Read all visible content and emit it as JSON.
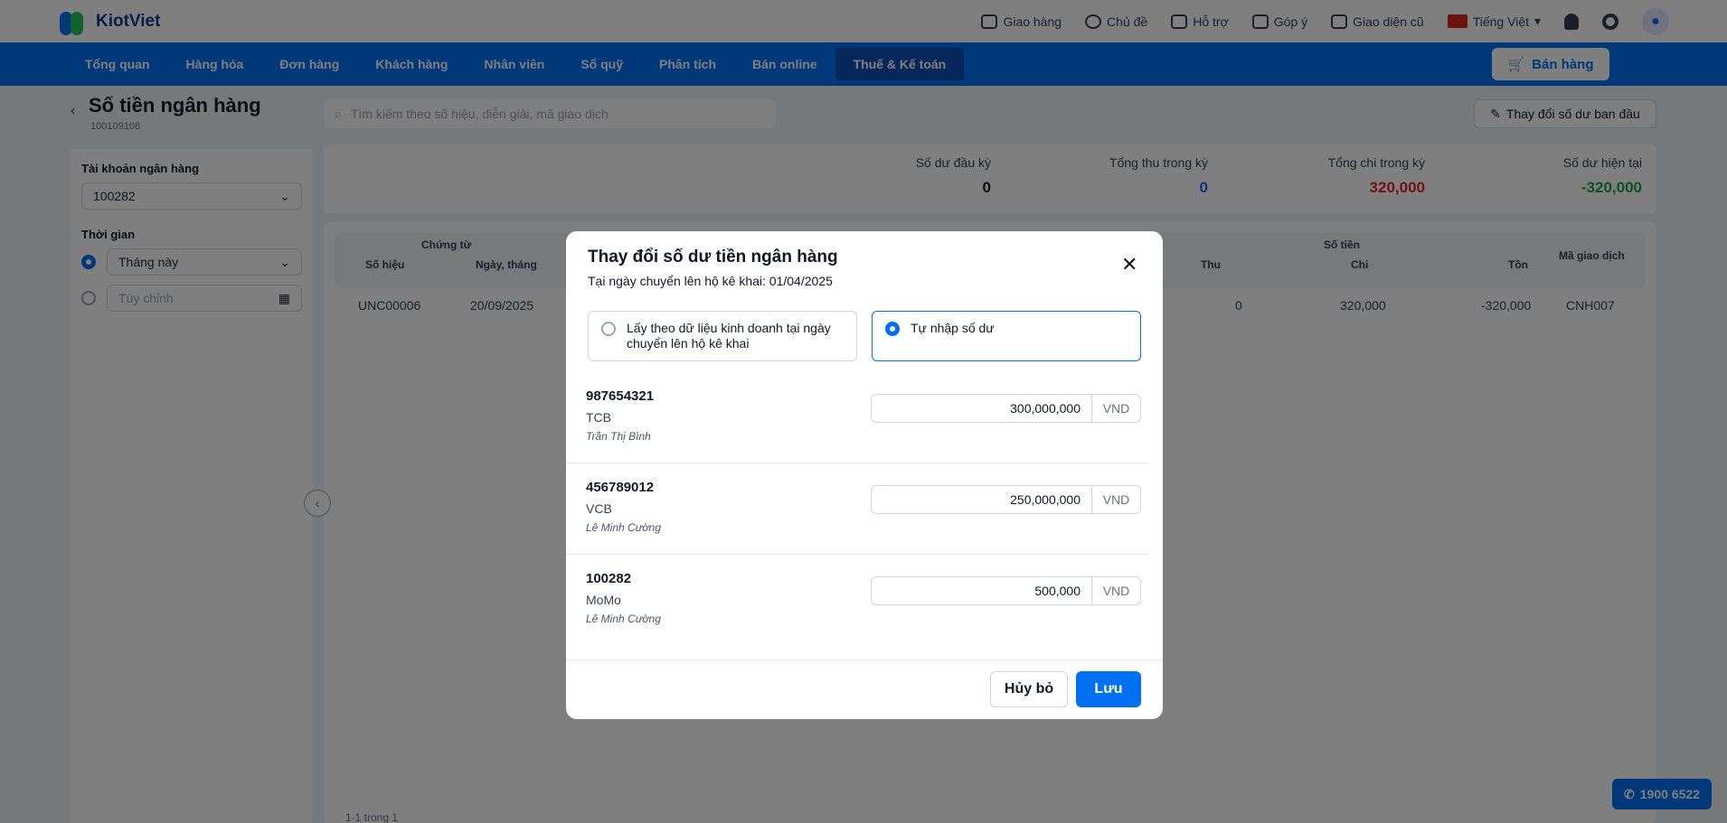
{
  "colors": {
    "brand": "#0070f3",
    "positive": "#16a34a",
    "negative": "#dc2626",
    "accent_blue": "#2563eb"
  },
  "app": {
    "name": "KiotViet"
  },
  "topbar": {
    "items": [
      {
        "label": "Giao hàng",
        "icon": "headset-icon"
      },
      {
        "label": "Chủ đề",
        "icon": "palette-icon"
      },
      {
        "label": "Hỗ trợ",
        "icon": "chat-icon"
      },
      {
        "label": "Góp ý",
        "icon": "feedback-icon"
      },
      {
        "label": "Giao diện cũ",
        "icon": "monitor-icon"
      }
    ],
    "language": "Tiếng Việt"
  },
  "nav": {
    "items": [
      "Tổng quan",
      "Hàng hóa",
      "Đơn hàng",
      "Khách hàng",
      "Nhân viên",
      "Sổ quỹ",
      "Phân tích",
      "Bán online",
      "Thuế & Kế toán"
    ],
    "active_index": 8,
    "sell_label": "Bán hàng"
  },
  "page": {
    "title": "Số tiền ngân hàng",
    "subtitle": "100109108",
    "search_placeholder": "Tìm kiếm theo số hiệu, diễn giải, mã giao dịch",
    "change_button": "Thay đổi số dư ban đầu"
  },
  "sidebar": {
    "account_label": "Tài khoản ngân hàng",
    "account_value": "100282",
    "time_label": "Thời gian",
    "time_option": "Tháng này",
    "custom_placeholder": "Tùy chỉnh"
  },
  "summary": [
    {
      "label": "Số dư đầu kỳ",
      "value": "0",
      "color": "#111827"
    },
    {
      "label": "Tổng thu trong kỳ",
      "value": "0",
      "color": "#2563eb"
    },
    {
      "label": "Tổng chi trong kỳ",
      "value": "320,000",
      "color": "#dc2626"
    },
    {
      "label": "Số dư hiện tại",
      "value": "-320,000",
      "color": "#16a34a"
    }
  ],
  "table": {
    "group_voucher": "Chứng từ",
    "group_amount": "Số tiền",
    "col_number": "Số hiệu",
    "col_date": "Ngày, tháng",
    "col_in": "Thu",
    "col_out": "Chi",
    "col_balance": "Tồn",
    "col_code": "Mã giao dịch",
    "row": {
      "number": "UNC00006",
      "date": "20/09/2025",
      "in": "0",
      "out": "320,000",
      "balance": "-320,000",
      "code": "CNH007"
    },
    "pager": "1-1 trong 1"
  },
  "hotline": "1900 6522",
  "modal": {
    "title": "Thay đổi số dư tiền ngân hàng",
    "subtitle": "Tại ngày chuyển lên hộ kê khai: 01/04/2025",
    "option_business": "Lấy theo dữ liệu kinh doanh tại ngày chuyển lên hộ kê khai",
    "option_manual": "Tự nhập số dư",
    "accounts": [
      {
        "number": "987654321",
        "bank": "TCB",
        "owner": "Trần Thị Bình",
        "amount": "300,000,000",
        "unit": "VND"
      },
      {
        "number": "456789012",
        "bank": "VCB",
        "owner": "Lê Minh Cường",
        "amount": "250,000,000",
        "unit": "VND"
      },
      {
        "number": "100282",
        "bank": "MoMo",
        "owner": "Lê Minh Cường",
        "amount": "500,000",
        "unit": "VND"
      }
    ],
    "cancel_label": "Hủy bỏ",
    "save_label": "Lưu"
  }
}
